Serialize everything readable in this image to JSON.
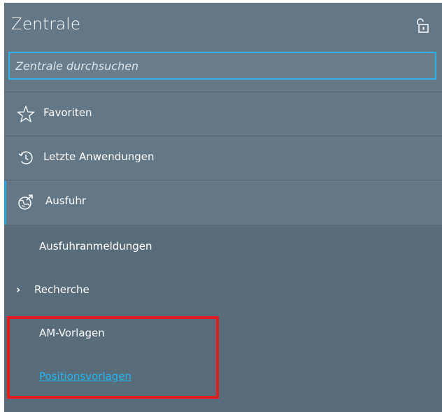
{
  "header": {
    "title": "Zentrale",
    "lock_icon": "unlock-icon"
  },
  "search": {
    "placeholder": "Zentrale durchsuchen",
    "value": ""
  },
  "menu": {
    "items": [
      {
        "label": "Favoriten",
        "icon": "star-icon"
      },
      {
        "label": "Letzte Anwendungen",
        "icon": "history-icon"
      },
      {
        "label": "Ausfuhr",
        "icon": "globe-export-icon",
        "expanded": true
      }
    ],
    "subitems": [
      {
        "label": "Ausfuhranmeldungen"
      },
      {
        "label": "Recherche",
        "icon": "chevron-right-icon"
      },
      {
        "label": "AM-Vorlagen"
      },
      {
        "label": "Positionsvorlagen",
        "active_link": true
      }
    ]
  },
  "colors": {
    "panel": "#596c7a",
    "header": "#637786",
    "search_border": "#2bb5e8",
    "link": "#21b5f2",
    "highlight": "#e01e1e"
  }
}
